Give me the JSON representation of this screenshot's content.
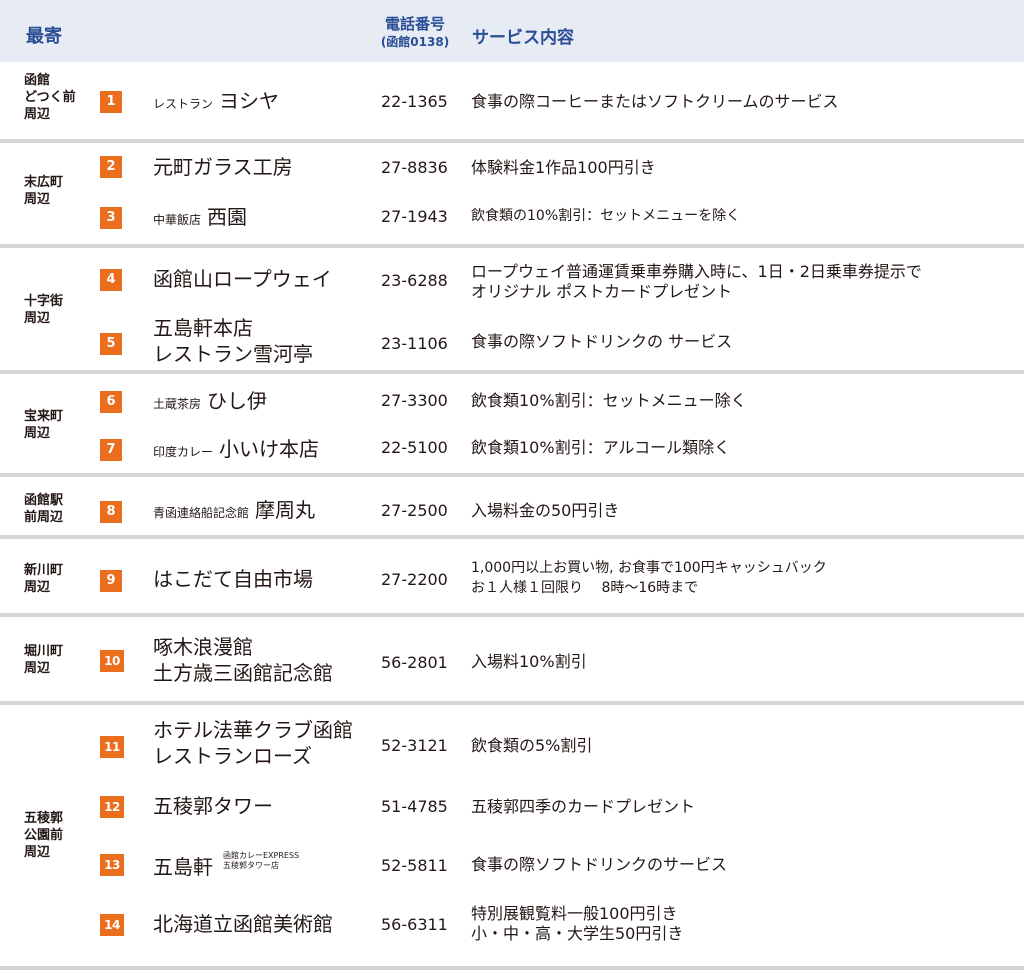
{
  "header": {
    "nearest": "最寄",
    "phone_title": "電話番号",
    "phone_sub": "(函館0138)",
    "service": "サービス内容"
  },
  "rows": [
    {
      "area": "函館\nどつく前\n周辺",
      "num": "1",
      "pre": "レストラン",
      "name": "ヨシヤ",
      "phone": "22-1365",
      "service": "食事の際コーヒーまたはソフトクリームのサービス"
    },
    {
      "area": "末広町\n周辺",
      "num": "2",
      "name": "元町ガラス工房",
      "phone": "27-8836",
      "service": "体験料金1作品100円引き"
    },
    {
      "num": "3",
      "pre": "中華飯店",
      "name": "西園",
      "phone": "27-1943",
      "service": "飲食類の10%割引：セットメニューを除く"
    },
    {
      "area": "十字街\n周辺",
      "num": "4",
      "name": "函館山ロープウェイ",
      "phone": "23-6288",
      "service": "ロープウェイ普通運賃乗車券購入時に、1日・2日乗車券提示で\nオリジナル ポストカードプレゼント"
    },
    {
      "num": "5",
      "name": "五島軒本店\nレストラン雪河亭",
      "phone": "23-1106",
      "service": "食事の際ソフトドリンクの サービス"
    },
    {
      "area": "宝来町\n周辺",
      "num": "6",
      "pre": "土蔵茶房",
      "name": "ひし伊",
      "phone": "27-3300",
      "service": "飲食類10%割引：セットメニュー除く"
    },
    {
      "num": "7",
      "pre": "印度カレー",
      "name": "小いけ本店",
      "phone": "22-5100",
      "service": "飲食類10%割引：アルコール類除く"
    },
    {
      "area": "函館駅\n前周辺",
      "num": "8",
      "pre": "青函連絡船記念館",
      "name": "摩周丸",
      "phone": "27-2500",
      "service": "入場料金の50円引き"
    },
    {
      "area": "新川町\n周辺",
      "num": "9",
      "name": "はこだて自由市場",
      "phone": "27-2200",
      "service": "1,000円以上お買い物, お食事で100円キャッシュバック\nお１人様１回限り　 8時〜16時まで"
    },
    {
      "area": "堀川町\n周辺",
      "num": "10",
      "name": "啄木浪漫館\n土方歳三函館記念館",
      "phone": "56-2801",
      "service": "入場料10%割引"
    },
    {
      "area": "五稜郭\n公園前\n周辺",
      "num": "11",
      "name": "ホテル法華クラブ函館\nレストランローズ",
      "phone": "52-3121",
      "service": "飲食類の5%割引"
    },
    {
      "num": "12",
      "name": "五稜郭タワー",
      "phone": "51-4785",
      "service": "五稜郭四季のカードプレゼント"
    },
    {
      "num": "13",
      "name": "五島軒",
      "post": "函館カレーEXPRESS\n五稜郭タワー店",
      "phone": "52-5811",
      "service": "食事の際ソフトドリンクのサービス"
    },
    {
      "num": "14",
      "name": "北海道立函館美術館",
      "phone": "56-6311",
      "service": "特別展観覧料一般100円引き\n小・中・高・大学生50円引き"
    }
  ]
}
